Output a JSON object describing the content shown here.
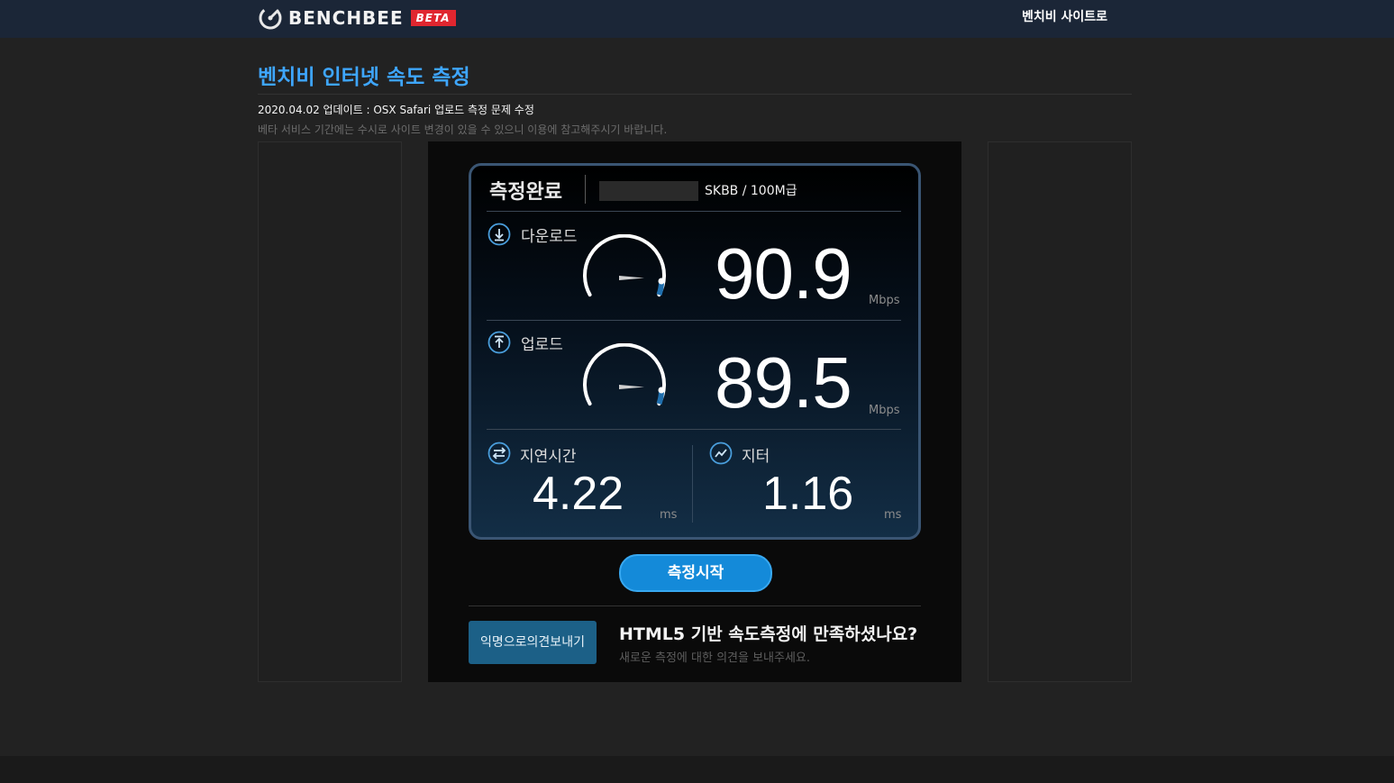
{
  "header": {
    "brand": "BENCHBEE",
    "badge": "BETA",
    "site_link": "벤치비 사이트로"
  },
  "page": {
    "title": "벤치비 인터넷 속도 측정",
    "notice": "2020.04.02 업데이트 : OSX Safari 업로드 측정 문제 수정",
    "subnotice": "베타 서비스 기간에는 수시로 사이트 변경이 있을 수 있으니 이용에 참고해주시기 바랍니다."
  },
  "result": {
    "status": "측정완료",
    "isp": "SKBB / 100M급",
    "download": {
      "label": "다운로드",
      "value": "90.9",
      "unit": "Mbps"
    },
    "upload": {
      "label": "업로드",
      "value": "89.5",
      "unit": "Mbps"
    },
    "latency": {
      "label": "지연시간",
      "value": "4.22",
      "unit": "ms"
    },
    "jitter": {
      "label": "지터",
      "value": "1.16",
      "unit": "ms"
    }
  },
  "actions": {
    "start_label": "측정시작",
    "feedback_label": "익명으로의견보내기",
    "feedback_title": "HTML5 기반 속도측정에 만족하셨나요?",
    "feedback_sub": "새로운 측정에 대한 의견을 보내주세요."
  },
  "colors": {
    "accent": "#3ea6ff",
    "button": "#148ad9",
    "badge": "#e0262f",
    "topbar": "#1b2637"
  },
  "icons": {
    "logo": "gauge-logo-icon",
    "download": "download-circle-icon",
    "upload": "upload-circle-icon",
    "latency": "swap-arrows-icon",
    "jitter": "trend-icon"
  }
}
